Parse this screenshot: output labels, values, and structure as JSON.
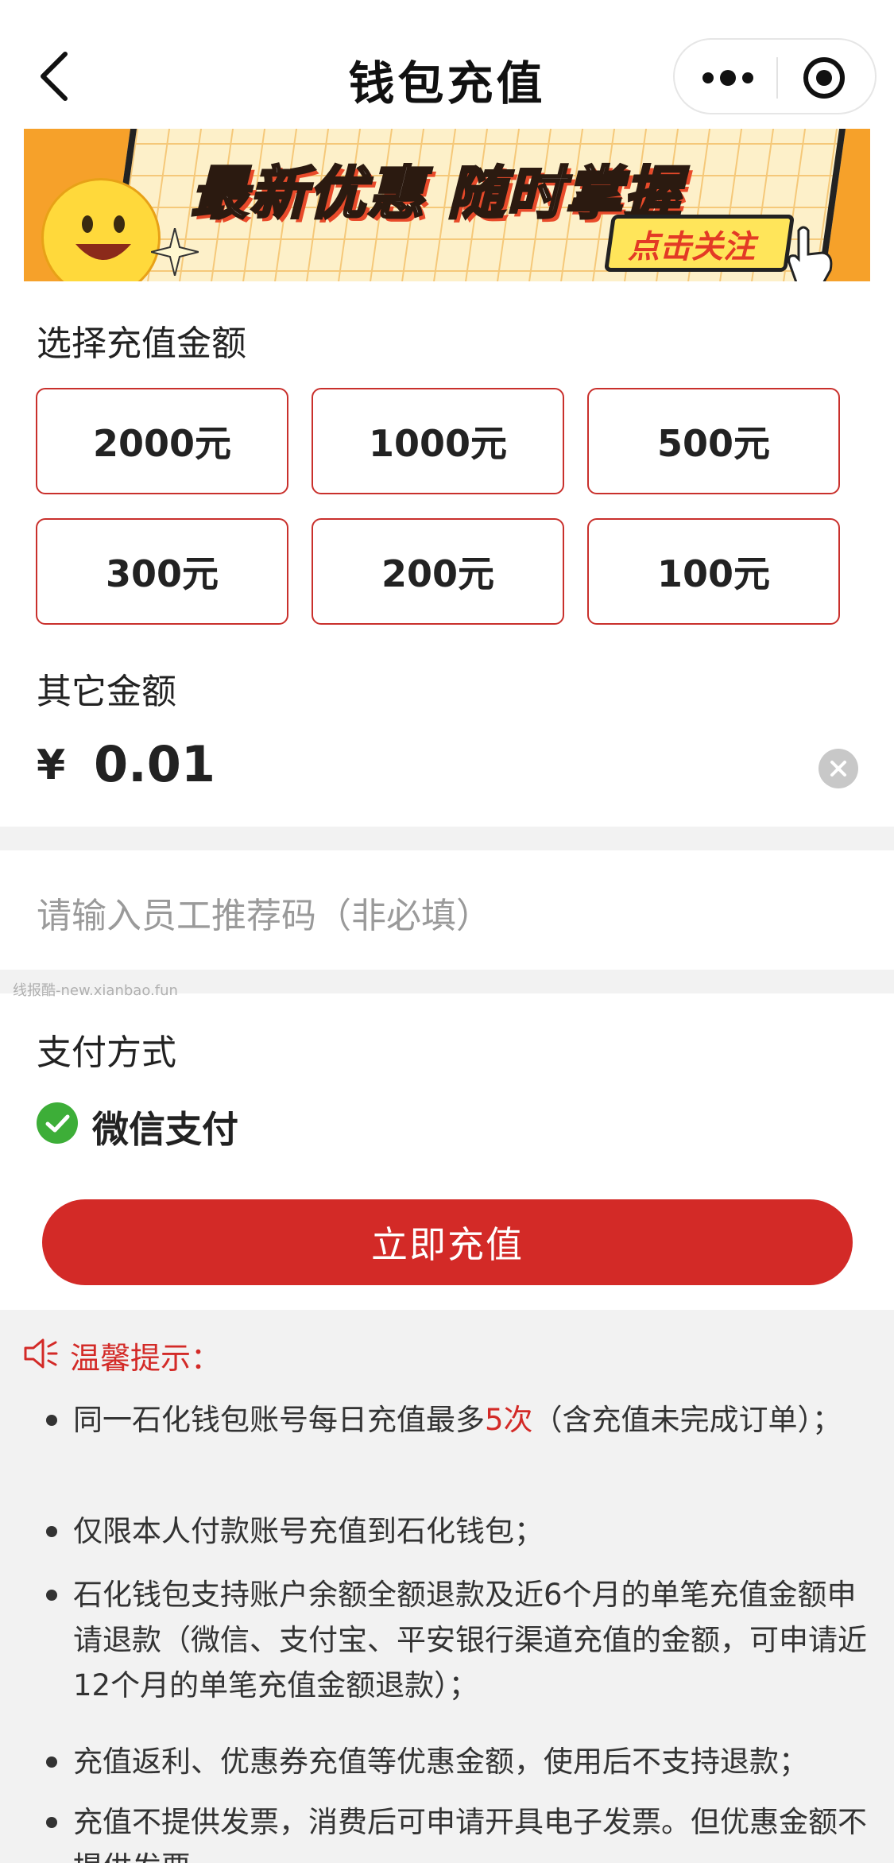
{
  "nav": {
    "title": "钱包充值"
  },
  "banner": {
    "title": "最新优惠 随时掌握",
    "button": "点击关注"
  },
  "amount_section": {
    "label": "选择充值金额",
    "options": [
      "2000元",
      "1000元",
      "500元",
      "300元",
      "200元",
      "100元"
    ]
  },
  "other_amount": {
    "label": "其它金额",
    "currency": "¥",
    "value": "0.01"
  },
  "referral": {
    "placeholder": "请输入员工推荐码（非必填）"
  },
  "watermark": "线报酷-new.xianbao.fun",
  "payment": {
    "label": "支付方式",
    "method": "微信支付"
  },
  "submit": {
    "label": "立即充值"
  },
  "tips": {
    "title": "温馨提示：",
    "items": [
      {
        "pre": "同一石化钱包账号每日充值最多",
        "highlight": "5次",
        "post": "（含充值未完成订单）；"
      },
      {
        "text": "仅限本人付款账号充值到石化钱包；"
      },
      {
        "text": "石化钱包支持账户余额全额退款及近6个月的单笔充值金额申请退款（微信、支付宝、平安银行渠道充值的金额，可申请近12个月的单笔充值金额退款）；"
      },
      {
        "text": "充值返利、优惠券充值等优惠金额，使用后不支持退款；"
      },
      {
        "text": "充值不提供发票，消费后可申请开具电子发票。但优惠金额不提供发票。"
      }
    ]
  },
  "colors": {
    "accent": "#d32a27",
    "border": "#c9302c",
    "wechat": "#3dae38",
    "gap": "#f2f2f2"
  }
}
